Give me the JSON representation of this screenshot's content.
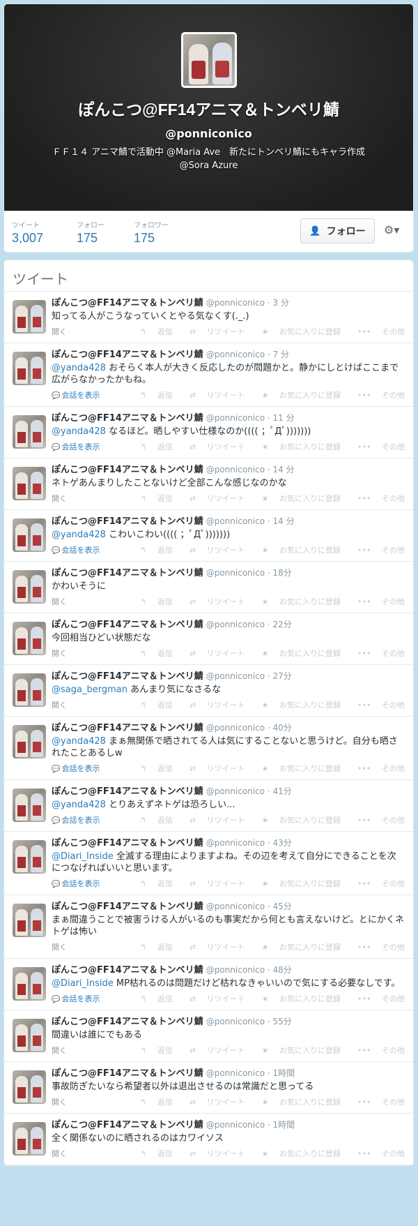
{
  "profile": {
    "name": "ぽんこつ@FF14アニマ＆トンベリ鯖",
    "handle": "@ponniconico",
    "bio_line1": "ＦＦ１４ アニマ鯖で活動中 @Maria Ave　新たにトンベリ鯖にもキャラ作成",
    "bio_line2": "@Sora Azure",
    "follow_button": "フォロー",
    "stats": [
      {
        "label": "ツイート",
        "value": "3,007"
      },
      {
        "label": "フォロー",
        "value": "175"
      },
      {
        "label": "フォロワー",
        "value": "175"
      }
    ]
  },
  "tweets_title": "ツイート",
  "actions": {
    "reply": "返信",
    "retweet": "リツイート",
    "favorite": "お気に入りに登録",
    "more": "その他"
  },
  "labels": {
    "expand": "開く",
    "conversation": "会話を表示"
  },
  "tweets": [
    {
      "name": "ぽんこつ@FF14アニマ＆トンベリ鯖",
      "handle": "@ponniconico",
      "time": "3 分",
      "mention": "",
      "text": "知ってる人がこうなっていくとやる気なくす(._.)",
      "conversation": false
    },
    {
      "name": "ぽんこつ@FF14アニマ＆トンベリ鯖",
      "handle": "@ponniconico",
      "time": "7 分",
      "mention": "@yanda428",
      "text": " おそらく本人が大きく反応したのが問題かと。静かにしとけばここまで広がらなかったかもね。",
      "conversation": true
    },
    {
      "name": "ぽんこつ@FF14アニマ＆トンベリ鯖",
      "handle": "@ponniconico",
      "time": "11 分",
      "mention": "@yanda428",
      "text": " なるほど。晒しやすい仕様なのか(((( ；ﾟДﾟ)))))))",
      "conversation": true
    },
    {
      "name": "ぽんこつ@FF14アニマ＆トンベリ鯖",
      "handle": "@ponniconico",
      "time": "14 分",
      "mention": "",
      "text": "ネトゲあんまりしたことないけど全部こんな感じなのかな",
      "conversation": false
    },
    {
      "name": "ぽんこつ@FF14アニマ＆トンベリ鯖",
      "handle": "@ponniconico",
      "time": "14 分",
      "mention": "@yanda428",
      "text": " こわいこわい(((( ；ﾟДﾟ)))))))",
      "conversation": true
    },
    {
      "name": "ぽんこつ@FF14アニマ＆トンベリ鯖",
      "handle": "@ponniconico",
      "time": "18分",
      "mention": "",
      "text": "かわいそうに",
      "conversation": false
    },
    {
      "name": "ぽんこつ@FF14アニマ＆トンベリ鯖",
      "handle": "@ponniconico",
      "time": "22分",
      "mention": "",
      "text": "今回相当ひどい状態だな",
      "conversation": false
    },
    {
      "name": "ぽんこつ@FF14アニマ＆トンベリ鯖",
      "handle": "@ponniconico",
      "time": "27分",
      "mention": "@saga_bergman",
      "text": " あんまり気になさるな",
      "conversation": false
    },
    {
      "name": "ぽんこつ@FF14アニマ＆トンベリ鯖",
      "handle": "@ponniconico",
      "time": "40分",
      "mention": "@yanda428",
      "text": " まぁ無関係で晒されてる人は気にすることないと思うけど。自分も晒されたことあるしw",
      "conversation": true
    },
    {
      "name": "ぽんこつ@FF14アニマ＆トンベリ鯖",
      "handle": "@ponniconico",
      "time": "41分",
      "mention": "@yanda428",
      "text": " とりあえずネトゲは恐ろしい...",
      "conversation": true
    },
    {
      "name": "ぽんこつ@FF14アニマ＆トンベリ鯖",
      "handle": "@ponniconico",
      "time": "43分",
      "mention": "@Diari_Inside",
      "text": " 全滅する理由によりますよね。その辺を考えて自分にできることを次につなげればいいと思います。",
      "conversation": true
    },
    {
      "name": "ぽんこつ@FF14アニマ＆トンベリ鯖",
      "handle": "@ponniconico",
      "time": "45分",
      "mention": "",
      "text": "まぁ間違うことで被害うける人がいるのも事実だから何とも言えないけど。とにかくネトゲは怖い",
      "conversation": false
    },
    {
      "name": "ぽんこつ@FF14アニマ＆トンベリ鯖",
      "handle": "@ponniconico",
      "time": "48分",
      "mention": "@Diari_Inside",
      "text": " MP枯れるのは問題だけど枯れなきゃいいので気にする必要なしです。",
      "conversation": true
    },
    {
      "name": "ぽんこつ@FF14アニマ＆トンベリ鯖",
      "handle": "@ponniconico",
      "time": "55分",
      "mention": "",
      "text": "間違いは誰にでもある",
      "conversation": false
    },
    {
      "name": "ぽんこつ@FF14アニマ＆トンベリ鯖",
      "handle": "@ponniconico",
      "time": "1時間",
      "mention": "",
      "text": "事故防ぎたいなら希望者以外は退出させるのは常識だと思ってる",
      "conversation": false
    },
    {
      "name": "ぽんこつ@FF14アニマ＆トンベリ鯖",
      "handle": "@ponniconico",
      "time": "1時間",
      "mention": "",
      "text": "全く関係ないのに晒されるのはカワイソス",
      "conversation": false
    }
  ]
}
